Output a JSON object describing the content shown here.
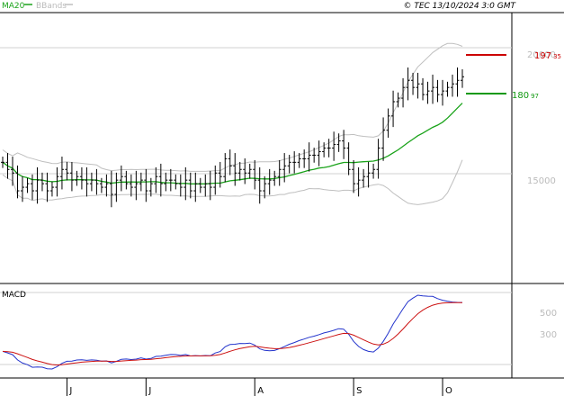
{
  "header": {
    "indicator_ma": "MA20",
    "indicator_bb": "BBands",
    "copyright": "© TEC 13/10/2024 3:0 GMT"
  },
  "colors": {
    "price_bars": "#000000",
    "ma": "#1aa31a",
    "bbands": "#bfbfbf",
    "macd_line": "#2233cc",
    "signal_line": "#cc1111",
    "resistance": "#cc0000",
    "support": "#119911",
    "grid": "#d0d0d0",
    "tick_text": "#bbbbbb"
  },
  "chart_data": [
    {
      "type": "ohlc",
      "ylim": [
        138,
        214
      ],
      "yticks": [
        {
          "label": "20000",
          "value": 200
        },
        {
          "label": "15000",
          "value": 150
        }
      ],
      "xticks": [
        {
          "label": "J",
          "index": 13
        },
        {
          "label": "J",
          "index": 29
        },
        {
          "label": "A",
          "index": 51
        },
        {
          "label": "S",
          "index": 71
        },
        {
          "label": "O",
          "index": 89
        }
      ],
      "levels": [
        {
          "name": "resistance",
          "value": 197.35,
          "label": "197",
          "label_small": "35"
        },
        {
          "name": "support",
          "value": 180.97,
          "label": "180",
          "label_small": "97"
        }
      ],
      "close": [
        172,
        170,
        169,
        164,
        165,
        166,
        164,
        167,
        166,
        164,
        165,
        168,
        170,
        169,
        167,
        168,
        167,
        166,
        167,
        166,
        165,
        166,
        163,
        167,
        168,
        166,
        165,
        166,
        167,
        164,
        166,
        168,
        166,
        167,
        167,
        166,
        165,
        167,
        164,
        166,
        165,
        166,
        165,
        169,
        168,
        173,
        171,
        169,
        170,
        169,
        170,
        167,
        164,
        166,
        167,
        168,
        170,
        171,
        172,
        172,
        173,
        173,
        174,
        174,
        175,
        176,
        176,
        177,
        178,
        176,
        170,
        166,
        167,
        168,
        169,
        170,
        176,
        181,
        185,
        189,
        190,
        193,
        195,
        193,
        194,
        191,
        192,
        193,
        191,
        192,
        193,
        194,
        195,
        196
      ]
    },
    {
      "type": "line",
      "title": "MACD",
      "yticks": [
        {
          "label": "500",
          "value": 500
        },
        {
          "label": "300",
          "value": 300
        }
      ]
    }
  ]
}
